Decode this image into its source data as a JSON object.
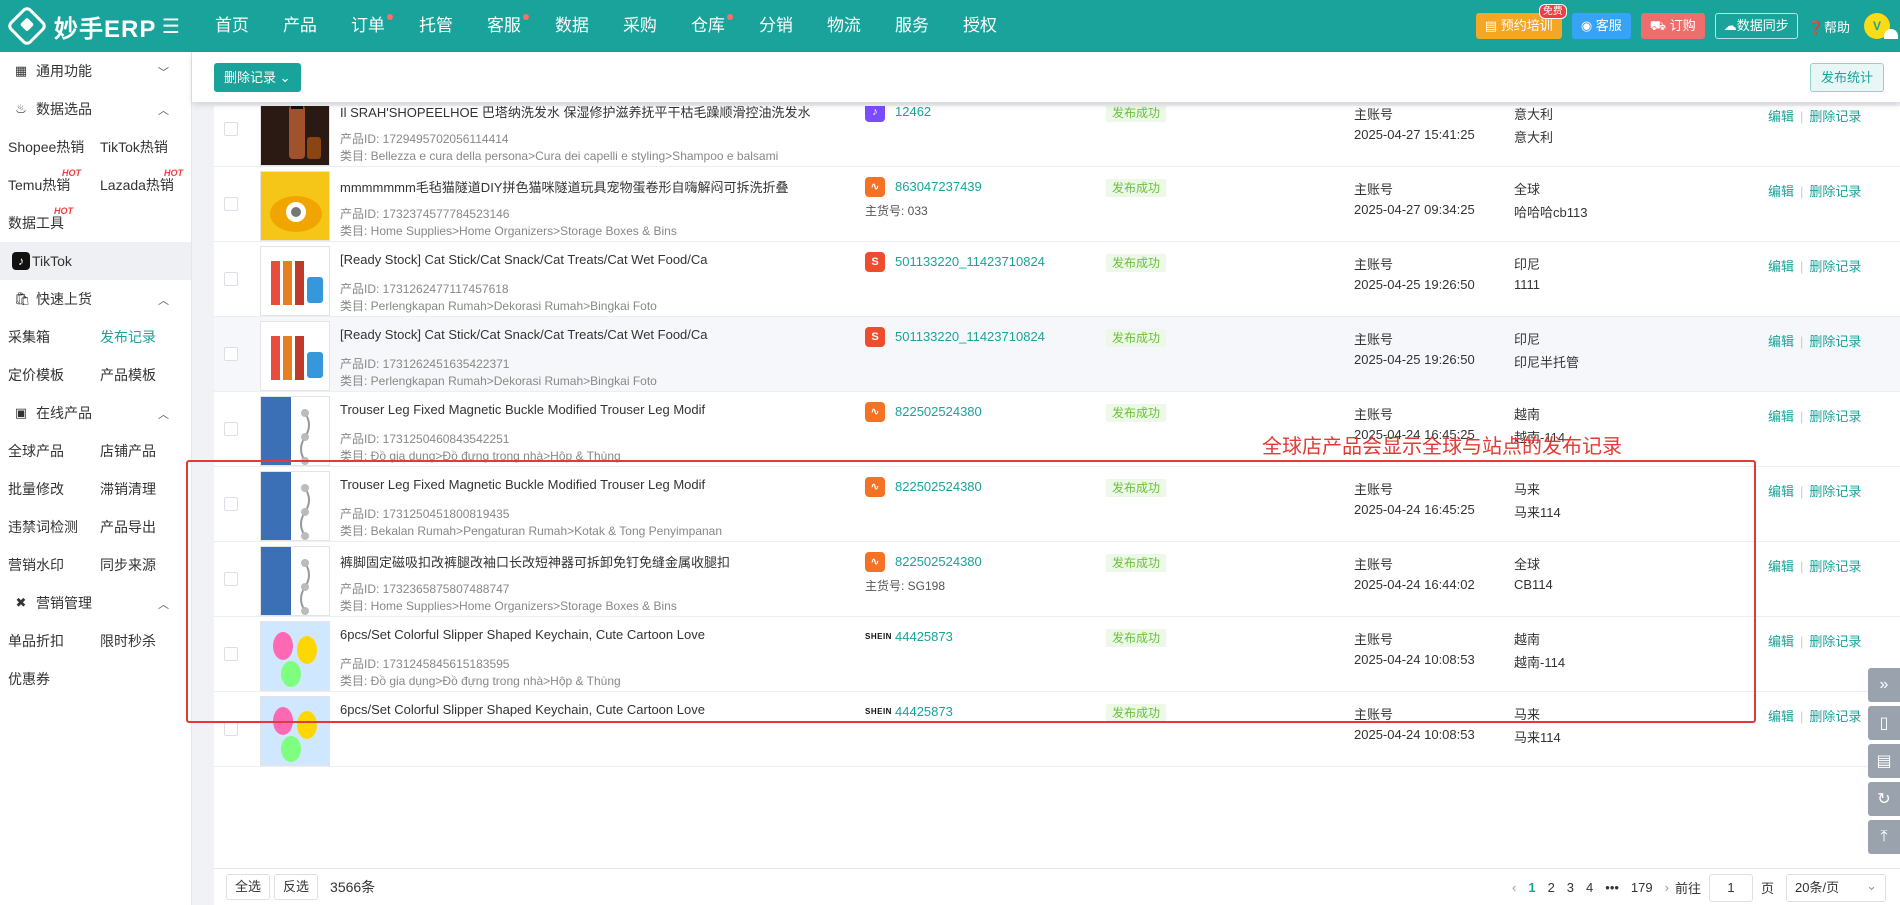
{
  "brand": {
    "name": "妙手ERP"
  },
  "nav": [
    {
      "label": "首页",
      "dot": false
    },
    {
      "label": "产品",
      "dot": false
    },
    {
      "label": "订单",
      "dot": true
    },
    {
      "label": "托管",
      "dot": false
    },
    {
      "label": "客服",
      "dot": true
    },
    {
      "label": "数据",
      "dot": false
    },
    {
      "label": "采购",
      "dot": false
    },
    {
      "label": "仓库",
      "dot": true
    },
    {
      "label": "分销",
      "dot": false
    },
    {
      "label": "物流",
      "dot": false
    },
    {
      "label": "服务",
      "dot": false
    },
    {
      "label": "授权",
      "dot": false
    }
  ],
  "topright": {
    "training": "预约培训",
    "training_badge": "免费",
    "service": "客服",
    "order": "订购",
    "sync": "数据同步",
    "help": "帮助",
    "avatar": "V"
  },
  "sidebar": {
    "common": "通用功能",
    "data_select": "数据选品",
    "shopee_hot": "Shopee热销",
    "tiktok_hot": "TikTok热销",
    "temu_hot": "Temu热销",
    "lazada_hot": "Lazada热销",
    "data_tools": "数据工具",
    "hot": "HOT",
    "tiktok": "TikTok",
    "quick_upload": "快速上货",
    "collect_box": "采集箱",
    "publish_records": "发布记录",
    "pricing_tpl": "定价模板",
    "product_tpl": "产品模板",
    "online_products": "在线产品",
    "global_products": "全球产品",
    "store_products": "店铺产品",
    "batch_edit": "批量修改",
    "slow_clean": "滞销清理",
    "banned_check": "违禁词检测",
    "product_export": "产品导出",
    "watermark": "营销水印",
    "sync_source": "同步来源",
    "marketing": "营销管理",
    "single_discount": "单品折扣",
    "flash_sale": "限时秒杀",
    "coupon": "优惠券"
  },
  "toolbar": {
    "delete": "删除记录",
    "stats": "发布统计"
  },
  "labels": {
    "pid_prefix": "产品ID: ",
    "cat_prefix": "类目: ",
    "sku_prefix": "主货号: ",
    "edit": "编辑",
    "delete": "删除记录"
  },
  "rows": [
    {
      "title": "Il SRAH'SHOPEELHOE 巴塔纳洗发水 保湿修护滋养抚平干枯毛躁顺滑控油洗发水",
      "pid": "1729495702056114414",
      "cat": "Bellezza e cura della persona>Cura dei capelli e styling>Shampoo e balsami",
      "platform": "tiktok",
      "platform_glyph": "♪",
      "listing": "12462",
      "sku": "",
      "status": "发布成功",
      "account": "主账号",
      "time": "2025-04-27 15:41:25",
      "site": "意大利",
      "store": "意大利"
    },
    {
      "title": "mmmmmmm毛毡猫隧道DIY拼色猫咪隧道玩具宠物蛋卷形自嗨解闷可拆洗折叠",
      "pid": "1732374577784523146",
      "cat": "Home Supplies>Home Organizers>Storage Boxes & Bins",
      "platform": "lazada",
      "platform_glyph": "∿",
      "listing": "863047237439",
      "sku": "033",
      "status": "发布成功",
      "account": "主账号",
      "time": "2025-04-27 09:34:25",
      "site": "全球",
      "store": "哈哈哈cb113"
    },
    {
      "title": "[Ready Stock] Cat Stick/Cat Snack/Cat Treats/Cat Wet Food/Ca",
      "pid": "1731262477117457618",
      "cat": "Perlengkapan Rumah>Dekorasi Rumah>Bingkai Foto",
      "platform": "shopee",
      "platform_glyph": "S",
      "listing": "501133220_11423710824",
      "sku": "",
      "status": "发布成功",
      "account": "主账号",
      "time": "2025-04-25 19:26:50",
      "site": "印尼",
      "store": "1111"
    },
    {
      "title": "[Ready Stock] Cat Stick/Cat Snack/Cat Treats/Cat Wet Food/Ca",
      "pid": "1731262451635422371",
      "cat": "Perlengkapan Rumah>Dekorasi Rumah>Bingkai Foto",
      "platform": "shopee",
      "platform_glyph": "S",
      "listing": "501133220_11423710824",
      "sku": "",
      "status": "发布成功",
      "account": "主账号",
      "time": "2025-04-25 19:26:50",
      "site": "印尼",
      "store": "印尼半托管"
    },
    {
      "title": "Trouser Leg Fixed Magnetic Buckle Modified Trouser Leg Modif",
      "pid": "1731250460843542251",
      "cat": "Đồ gia dụng>Đồ đựng trong nhà>Hộp & Thùng",
      "platform": "lazada",
      "platform_glyph": "∿",
      "listing": "822502524380",
      "sku": "",
      "status": "发布成功",
      "account": "主账号",
      "time": "2025-04-24 16:45:25",
      "site": "越南",
      "store": "越南-114"
    },
    {
      "title": "Trouser Leg Fixed Magnetic Buckle Modified Trouser Leg Modif",
      "pid": "1731250451800819435",
      "cat": "Bekalan Rumah>Pengaturan Rumah>Kotak & Tong Penyimpanan",
      "platform": "lazada",
      "platform_glyph": "∿",
      "listing": "822502524380",
      "sku": "",
      "status": "发布成功",
      "account": "主账号",
      "time": "2025-04-24 16:45:25",
      "site": "马来",
      "store": "马来114"
    },
    {
      "title": "裤脚固定磁吸扣改裤腿改袖口长改短神器可拆卸免钉免缝金属收腿扣",
      "pid": "1732365875807488747",
      "cat": "Home Supplies>Home Organizers>Storage Boxes & Bins",
      "platform": "lazada",
      "platform_glyph": "∿",
      "listing": "822502524380",
      "sku": "SG198",
      "status": "发布成功",
      "account": "主账号",
      "time": "2025-04-24 16:44:02",
      "site": "全球",
      "store": "CB114"
    },
    {
      "title": "6pcs/Set Colorful Slipper Shaped Keychain, Cute Cartoon Love",
      "pid": "1731245845615183595",
      "cat": "Đồ gia dụng>Đồ đựng trong nhà>Hộp & Thùng",
      "platform": "shein",
      "platform_glyph": "SHEIN",
      "listing": "44425873",
      "sku": "",
      "status": "发布成功",
      "account": "主账号",
      "time": "2025-04-24 10:08:53",
      "site": "越南",
      "store": "越南-114"
    },
    {
      "title": "6pcs/Set Colorful Slipper Shaped Keychain, Cute Cartoon Love",
      "pid": "",
      "cat": "",
      "platform": "shein",
      "platform_glyph": "SHEIN",
      "listing": "44425873",
      "sku": "",
      "status": "发布成功",
      "account": "主账号",
      "time": "2025-04-24 10:08:53",
      "site": "马来",
      "store": "马来114"
    }
  ],
  "annotation": "全球店产品会显示全球与站点的发布记录",
  "footer": {
    "select_all": "全选",
    "invert": "反选",
    "total": "3566条",
    "pages": [
      "1",
      "2",
      "3",
      "4",
      "•••",
      "179"
    ],
    "goto_label": "前往",
    "goto_value": "1",
    "page_label": "页",
    "page_size": "20条/页"
  },
  "colors": {
    "primary": "#1aa39a",
    "annotation": "#e53935",
    "success": "#67c23a"
  }
}
